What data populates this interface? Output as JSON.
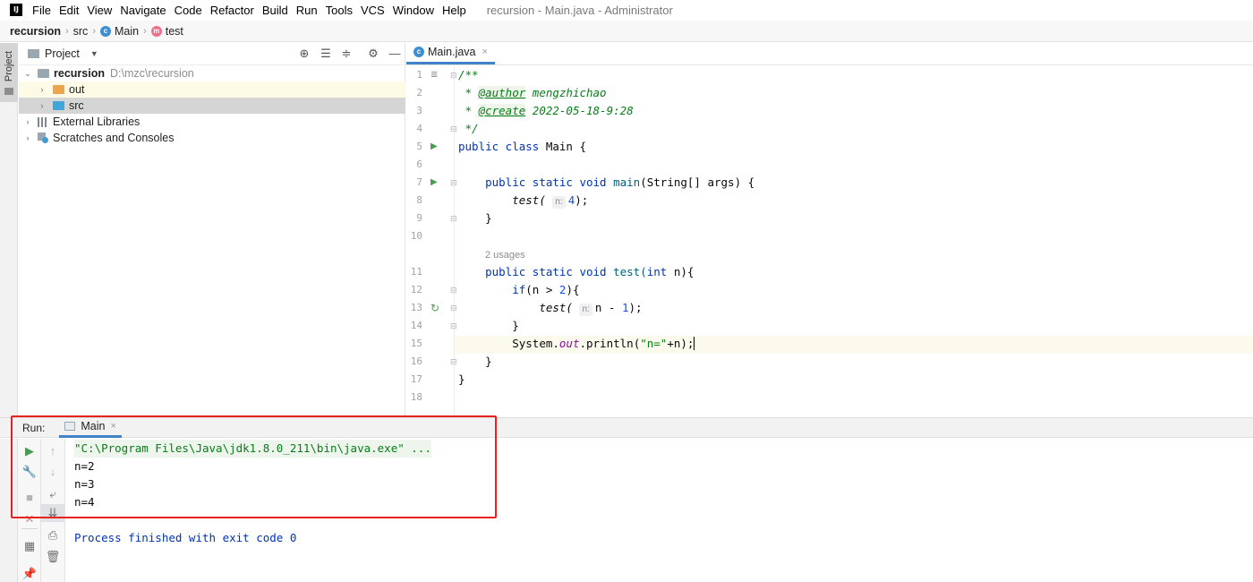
{
  "colors": {
    "accent": "#4083c9",
    "keyword": "#0033b3",
    "doc_comment": "#067d17",
    "highlight_box": "#e8231f",
    "run_green": "#499c54"
  },
  "menubar": {
    "logo": "IJ",
    "items": [
      "File",
      "Edit",
      "View",
      "Navigate",
      "Code",
      "Refactor",
      "Build",
      "Run",
      "Tools",
      "VCS",
      "Window",
      "Help"
    ],
    "window_title": "recursion - Main.java - Administrator"
  },
  "breadcrumb": {
    "project": "recursion",
    "folder": "src",
    "class": "Main",
    "method": "test"
  },
  "left_stripe": {
    "project_tab": "Project"
  },
  "project_panel": {
    "title": "Project",
    "icons": [
      "locate-icon",
      "expand-all-icon",
      "collapse-all-icon",
      "gear-icon",
      "minimize-icon"
    ],
    "tree": {
      "root": {
        "name": "recursion",
        "path": "D:\\mzc\\recursion"
      },
      "out": "out",
      "src": "src",
      "libraries": "External Libraries",
      "scratches": "Scratches and Consoles"
    }
  },
  "editor": {
    "tab": "Main.java",
    "line_numbers": [
      "1",
      "2",
      "3",
      "4",
      "5",
      "6",
      "7",
      "8",
      "9",
      "10",
      "11",
      "12",
      "13",
      "14",
      "15",
      "16",
      "17",
      "18"
    ],
    "usages_hint": "2 usages",
    "param_hint": "n:",
    "doc": {
      "open": "/**",
      "author_tag": "@author",
      "author": " mengzhichao",
      "create_tag": "@create",
      "created": " 2022-05-18-9:28",
      "close": " */"
    },
    "code": {
      "l5": "Main",
      "l7": "main(String[] args) {",
      "l8_call": "test(",
      "l8_arg": "4",
      "l8_end": ");",
      "l9": "}",
      "l11_name": "test(",
      "l11_param": "int",
      "l11_rest": " n){",
      "l12_if": "if",
      "l12_cond": "(n > ",
      "l12_num": "2",
      "l12_end": "){",
      "l13_call": "test(",
      "l13_arg": "n - ",
      "l13_num": "1",
      "l13_end": ");",
      "l14": "}",
      "l15_sys": "System.",
      "l15_out": "out",
      "l15_call": ".println(",
      "l15_str": "\"n=\"",
      "l15_end": "+n);",
      "l16": "}",
      "l17": "}"
    }
  },
  "run_panel": {
    "label": "Run:",
    "tab": "Main",
    "console": {
      "command": "\"C:\\Program Files\\Java\\jdk1.8.0_211\\bin\\java.exe\" ...",
      "output": [
        "n=2",
        "n=3",
        "n=4"
      ],
      "exit": "Process finished with exit code 0"
    }
  }
}
